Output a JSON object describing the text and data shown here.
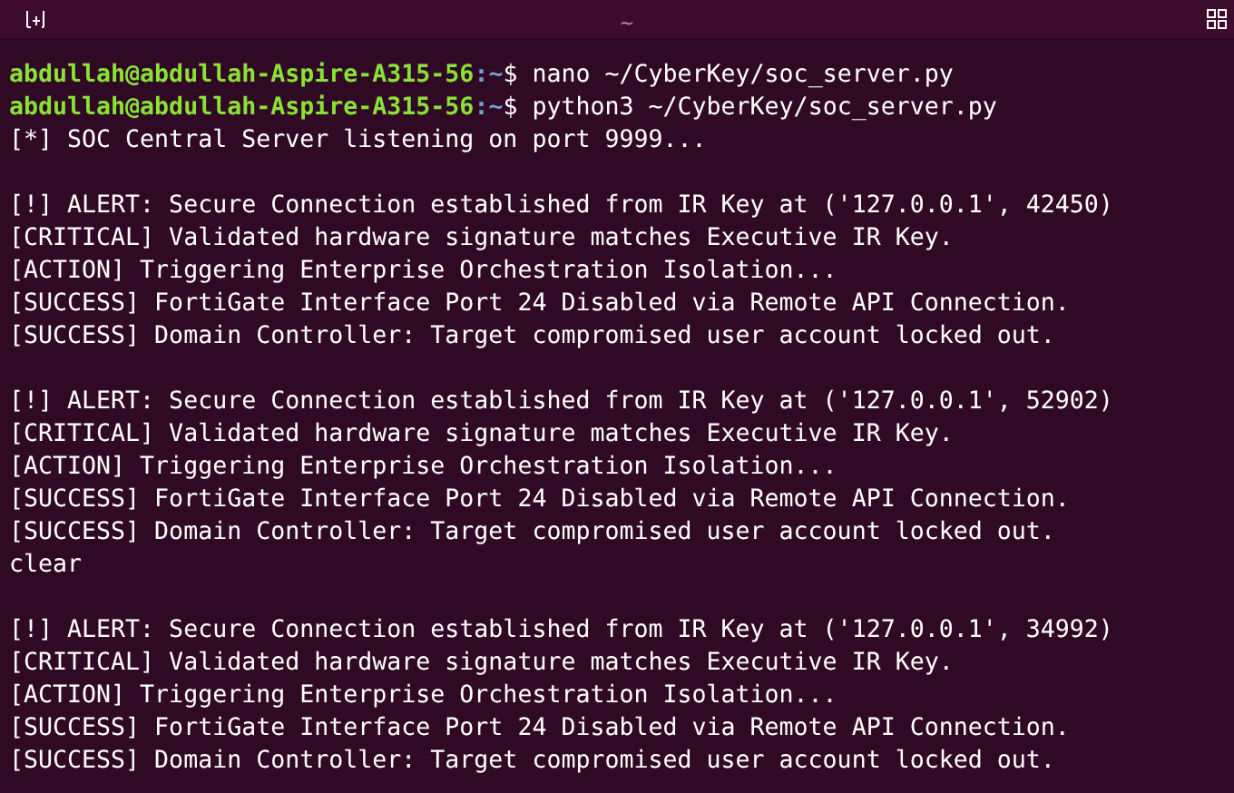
{
  "header": {
    "subtitle": "~"
  },
  "lines": [
    {
      "kind": "prompt",
      "user_host": "abdullah@abdullah-Aspire-A315-56",
      "path": ":~",
      "symbol": "$",
      "command": "nano ~/CyberKey/soc_server.py"
    },
    {
      "kind": "prompt",
      "user_host": "abdullah@abdullah-Aspire-A315-56",
      "path": ":~",
      "symbol": "$",
      "command": "python3 ~/CyberKey/soc_server.py"
    },
    {
      "kind": "output",
      "text": "[*] SOC Central Server listening on port 9999..."
    },
    {
      "kind": "blank"
    },
    {
      "kind": "output",
      "text": "[!] ALERT: Secure Connection established from IR Key at ('127.0.0.1', 42450)"
    },
    {
      "kind": "output",
      "text": "[CRITICAL] Validated hardware signature matches Executive IR Key."
    },
    {
      "kind": "output",
      "text": "[ACTION] Triggering Enterprise Orchestration Isolation..."
    },
    {
      "kind": "output",
      "text": "[SUCCESS] FortiGate Interface Port 24 Disabled via Remote API Connection."
    },
    {
      "kind": "output",
      "text": "[SUCCESS] Domain Controller: Target compromised user account locked out."
    },
    {
      "kind": "blank"
    },
    {
      "kind": "output",
      "text": "[!] ALERT: Secure Connection established from IR Key at ('127.0.0.1', 52902)"
    },
    {
      "kind": "output",
      "text": "[CRITICAL] Validated hardware signature matches Executive IR Key."
    },
    {
      "kind": "output",
      "text": "[ACTION] Triggering Enterprise Orchestration Isolation..."
    },
    {
      "kind": "output",
      "text": "[SUCCESS] FortiGate Interface Port 24 Disabled via Remote API Connection."
    },
    {
      "kind": "output",
      "text": "[SUCCESS] Domain Controller: Target compromised user account locked out."
    },
    {
      "kind": "output",
      "text": "clear"
    },
    {
      "kind": "blank"
    },
    {
      "kind": "output",
      "text": "[!] ALERT: Secure Connection established from IR Key at ('127.0.0.1', 34992)"
    },
    {
      "kind": "output",
      "text": "[CRITICAL] Validated hardware signature matches Executive IR Key."
    },
    {
      "kind": "output",
      "text": "[ACTION] Triggering Enterprise Orchestration Isolation..."
    },
    {
      "kind": "output",
      "text": "[SUCCESS] FortiGate Interface Port 24 Disabled via Remote API Connection."
    },
    {
      "kind": "output",
      "text": "[SUCCESS] Domain Controller: Target compromised user account locked out."
    }
  ]
}
